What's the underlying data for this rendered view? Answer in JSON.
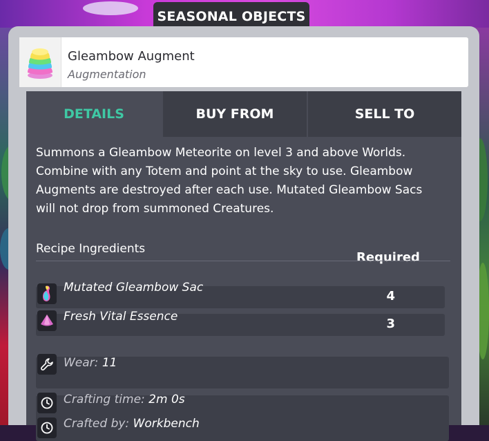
{
  "header": {
    "title": "SEASONAL OBJECTS"
  },
  "item": {
    "name": "Gleambow Augment",
    "type": "Augmentation"
  },
  "tabs": [
    {
      "label": "DETAILS",
      "active": true
    },
    {
      "label": "BUY FROM",
      "active": false
    },
    {
      "label": "SELL TO",
      "active": false
    }
  ],
  "description": "Summons a Gleambow Meteorite on level 3 and above Worlds. Combine with any Totem and point at the sky to use. Gleambow Augments are destroyed after each use. Mutated Gleambow Sacs will not drop from summoned Creatures.",
  "recipe": {
    "label": "Recipe Ingredients",
    "required_label": "Required",
    "ingredients": [
      {
        "name": "Mutated Gleambow Sac",
        "qty": "4",
        "icon": "gleambow-sac-icon"
      },
      {
        "name": "Fresh Vital Essence",
        "qty": "3",
        "icon": "vital-essence-icon"
      }
    ]
  },
  "stats": {
    "wear": {
      "label": "Wear:",
      "value": "11",
      "icon": "wrench-icon"
    },
    "crafting_time": {
      "label": "Crafting time:",
      "value": "2m 0s",
      "icon": "clock-icon"
    },
    "crafted_by": {
      "label": "Crafted by:",
      "value": "Workbench",
      "icon": "clock-icon"
    }
  },
  "colors": {
    "accent": "#3fc8a4",
    "panel": "#4a4c57",
    "frame": "#c4c6cc"
  }
}
